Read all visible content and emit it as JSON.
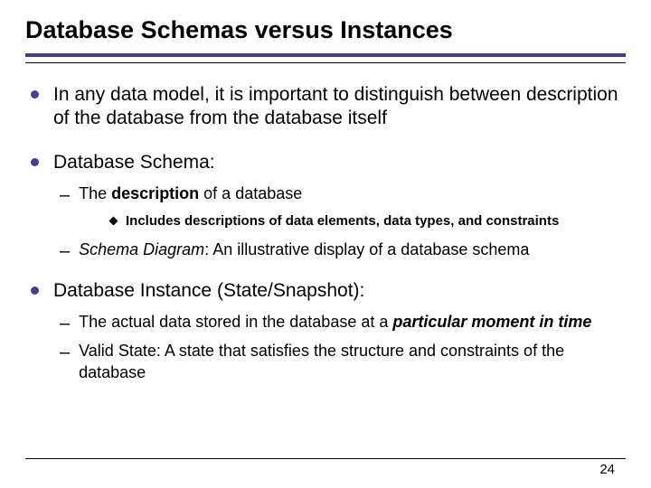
{
  "title": "Database Schemas versus Instances",
  "b1": "In any data model, it is important to distinguish between description of the database from the database itself",
  "b2": "Database Schema:",
  "b2_1_pre": "The ",
  "b2_1_bold": "description",
  "b2_1_post": " of a database",
  "b2_1_1": "Includes descriptions of data elements, data types, and constraints",
  "b2_2_italic": "Schema Diagram",
  "b2_2_post": ": An illustrative display of a database schema",
  "b3": "Database Instance (State/Snapshot):",
  "b3_1_pre": "The actual data stored in the database at a ",
  "b3_1_bolditalic": "particular moment in time",
  "b3_2": "Valid State: A state that satisfies the structure and constraints of the database",
  "page": "24"
}
